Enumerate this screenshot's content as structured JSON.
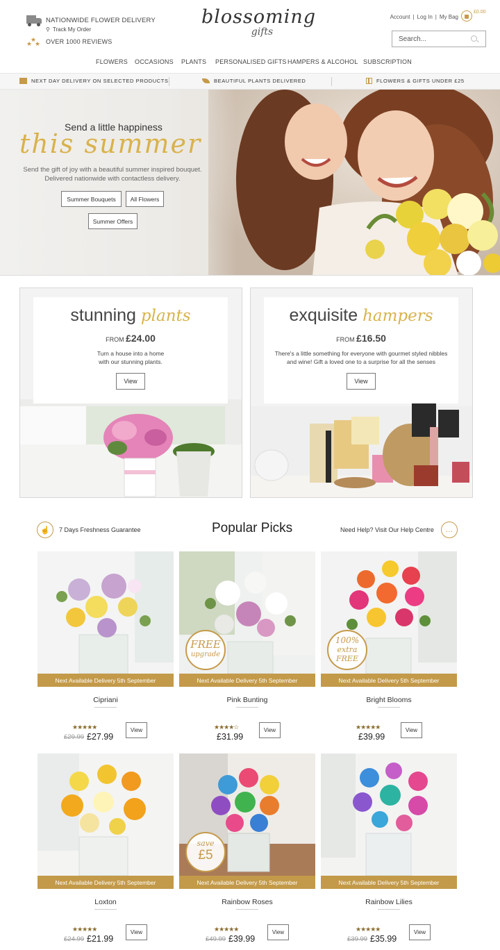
{
  "header": {
    "delivery": "NATIONWIDE FLOWER DELIVERY",
    "track": "Track My Order",
    "reviews": "OVER 1000 REVIEWS",
    "logo_main": "blossoming",
    "logo_sub": "gifts",
    "account": "Account",
    "login": "Log In",
    "bag": "My Bag",
    "bag_amount": "£0.00",
    "search_placeholder": "Search..."
  },
  "nav": [
    "FLOWERS",
    "OCCASIONS",
    "PLANTS",
    "PERSONALISED GIFTS",
    "HAMPERS & ALCOHOL",
    "SUBSCRIPTION"
  ],
  "strip": [
    "NEXT DAY DELIVERY ON SELECTED PRODUCTS",
    "BEAUTIFUL PLANTS DELIVERED",
    "FLOWERS & GIFTS UNDER £25"
  ],
  "hero": {
    "subtitle": "Send a little happiness",
    "script": "this summer",
    "desc1": "Send the gift of joy with a beautiful summer inspired bouquet.",
    "desc2": "Delivered nationwide with contactless delivery.",
    "btn1": "Summer Bouquets",
    "btn2": "All Flowers",
    "btn3": "Summer Offers"
  },
  "promos": [
    {
      "word": "stunning",
      "script": "plants",
      "from": "FROM",
      "price": "£24.00",
      "desc1": "Turn a house into a home",
      "desc2": "with our stunning plants.",
      "button": "View"
    },
    {
      "word": "exquisite",
      "script": "hampers",
      "from": "FROM",
      "price": "£16.50",
      "desc1": "There's a little something for everyone with gourmet styled nibbles",
      "desc2": "and wine! Gift a loved one to a surprise for all the senses",
      "button": "View"
    }
  ],
  "popular": {
    "guarantee": "7 Days Freshness Guarantee",
    "title": "Popular Picks",
    "help": "Need Help? Visit Our Help Centre"
  },
  "products": [
    {
      "name": "Cipriani",
      "was": "£29.99",
      "price": "£27.99",
      "rating": 5,
      "stars": "★★★★★",
      "delivery": "Next Available Delivery 5th September",
      "button": "View"
    },
    {
      "name": "Pink Bunting",
      "was": "",
      "price": "£31.99",
      "rating": 4,
      "stars": "★★★★☆",
      "delivery": "Next Available Delivery 5th September",
      "button": "View",
      "badge1": "FREE",
      "badge2": "upgrade"
    },
    {
      "name": "Bright Blooms",
      "was": "",
      "price": "£39.99",
      "rating": 4.5,
      "stars": "★★★★★",
      "delivery": "Next Available Delivery 5th September",
      "button": "View",
      "badge1": "100%",
      "badge2": "extra",
      "badge3": "FREE"
    },
    {
      "name": "Loxton",
      "was": "£24.99",
      "price": "£21.99",
      "rating": 5,
      "stars": "★★★★★",
      "delivery": "Next Available Delivery 5th September",
      "button": "View"
    },
    {
      "name": "Rainbow Roses",
      "was": "£49.99",
      "price": "£39.99",
      "rating": 5,
      "stars": "★★★★★",
      "delivery": "Next Available Delivery 5th September",
      "button": "View",
      "badge1": "save",
      "badge2": "£5"
    },
    {
      "name": "Rainbow Lilies",
      "was": "£39.99",
      "price": "£35.99",
      "rating": 5,
      "stars": "★★★★★",
      "delivery": "Next Available Delivery 5th September",
      "button": "View"
    }
  ],
  "colors": {
    "accent": "#c39a49",
    "script": "#d9b24c"
  }
}
